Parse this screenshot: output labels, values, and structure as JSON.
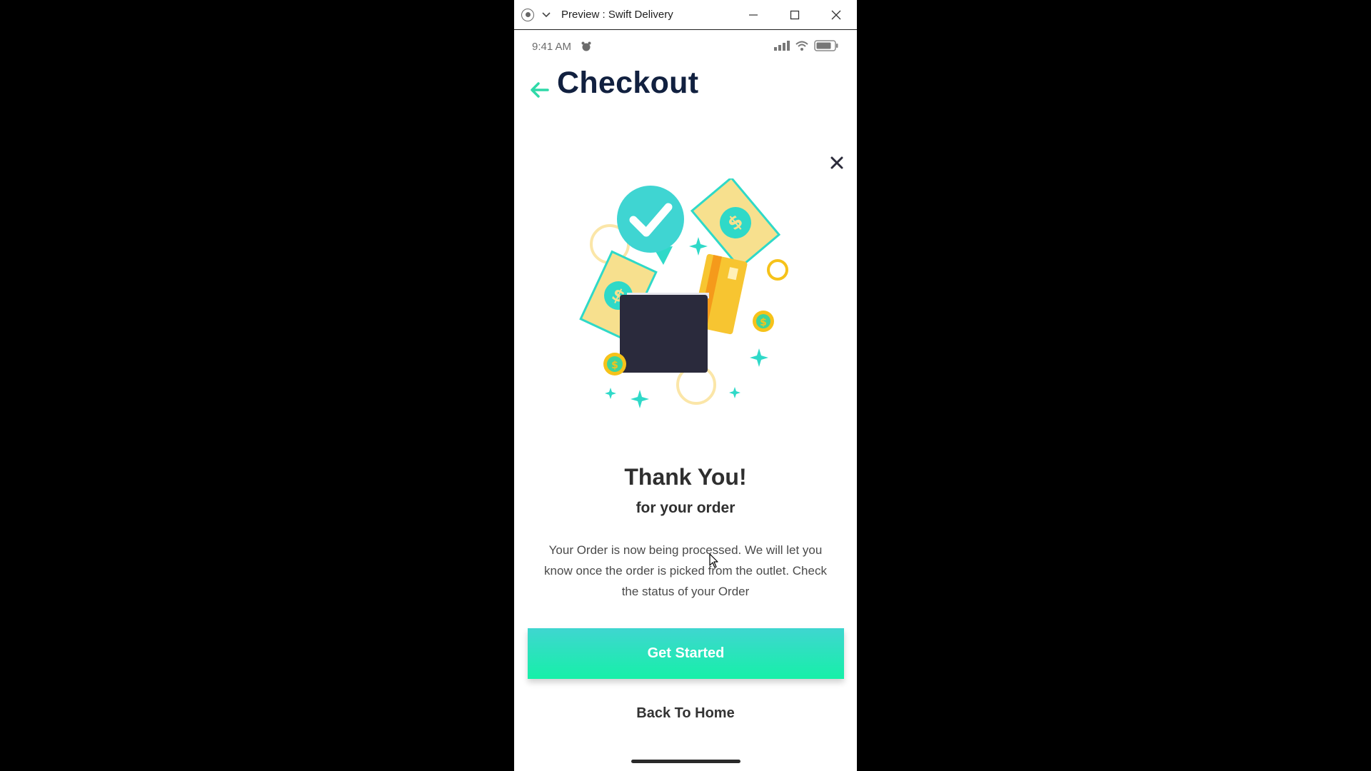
{
  "window": {
    "title": "Preview : Swift Delivery"
  },
  "status_bar": {
    "time": "9:41 AM"
  },
  "header": {
    "title": "Checkout"
  },
  "confirmation": {
    "heading": "Thank You!",
    "subheading": "for your order",
    "message": "Your Order is now being processed. We will let you know once the order is picked from the outlet. Check the status of your Order"
  },
  "actions": {
    "primary_label": "Get Started",
    "secondary_label": "Back To Home"
  },
  "colors": {
    "accent": "#2fd9b8",
    "title": "#11203f",
    "button_top": "#3fd6d0",
    "button_bottom": "#16f0a8"
  },
  "icons": {
    "back": "arrow-left-icon",
    "close": "close-icon",
    "illustration": "payment-success-illustration"
  }
}
